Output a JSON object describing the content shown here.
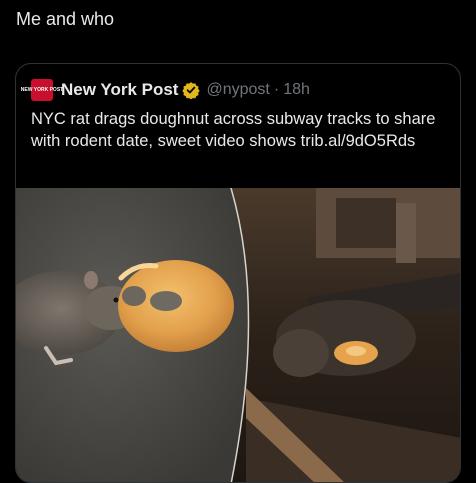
{
  "tweet": {
    "text": "Me and who"
  },
  "quoted": {
    "avatar_text": "NEW YORK POST",
    "author_name": "New York Post",
    "handle": "@nypost",
    "separator": "·",
    "time": "18h",
    "text": "NYC rat drags doughnut across subway tracks to share with rodent date, sweet video shows trib.al/9dO5Rds",
    "colors": {
      "brand": "#c8102e",
      "verified": "#e2b719"
    }
  }
}
